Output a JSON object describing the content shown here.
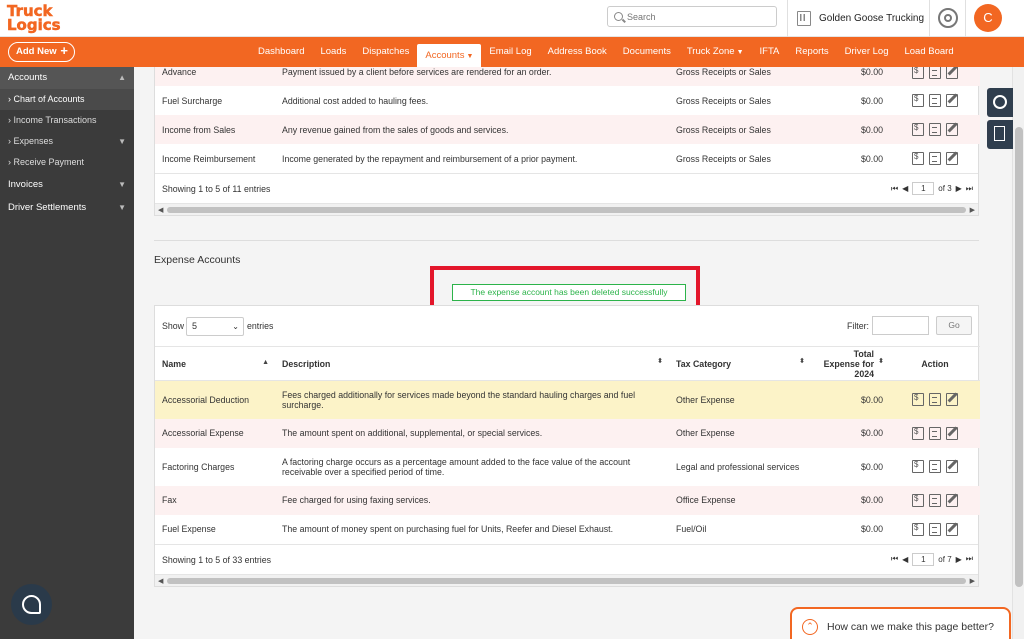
{
  "brand": {
    "logo_line1": "Truck",
    "logo_line2": "Logics"
  },
  "search": {
    "placeholder": "Search"
  },
  "company": {
    "name": "Golden Goose Trucking"
  },
  "user": {
    "initial": "C"
  },
  "nav": {
    "add_new": "Add New",
    "items": [
      "Dashboard",
      "Loads",
      "Dispatches",
      "Accounts",
      "Email Log",
      "Address Book",
      "Documents",
      "Truck Zone",
      "IFTA",
      "Reports",
      "Driver Log",
      "Load Board"
    ],
    "active": "Accounts"
  },
  "sidebar": {
    "accounts": "Accounts",
    "subs": [
      "Chart of Accounts",
      "Income Transactions",
      "Expenses",
      "Receive Payment"
    ],
    "invoices": "Invoices",
    "driver_settlements": "Driver Settlements"
  },
  "income_table": {
    "rows": [
      {
        "name": "Advance",
        "description": "Payment issued by a client before services are rendered for an order.",
        "tax": "Gross Receipts or Sales",
        "amount": "$0.00"
      },
      {
        "name": "Fuel Surcharge",
        "description": "Additional cost added to hauling fees.",
        "tax": "Gross Receipts or Sales",
        "amount": "$0.00"
      },
      {
        "name": "Income from Sales",
        "description": "Any revenue gained from the sales of goods and services.",
        "tax": "Gross Receipts or Sales",
        "amount": "$0.00"
      },
      {
        "name": "Income Reimbursement",
        "description": "Income generated by the repayment and reimbursement of a prior payment.",
        "tax": "Gross Receipts or Sales",
        "amount": "$0.00"
      }
    ],
    "info": "Showing 1 to 5 of 11 entries",
    "page": "1",
    "of_pages": "of 3"
  },
  "expense_section": {
    "title": "Expense Accounts",
    "alert": "The expense account has been deleted successfully",
    "show_label": "Show",
    "show_value": "5",
    "entries_label": "entries",
    "filter_label": "Filter:",
    "go": "Go",
    "headers": {
      "name": "Name",
      "description": "Description",
      "tax": "Tax Category",
      "total": "Total Expense for 2024",
      "action": "Action"
    },
    "rows": [
      {
        "name": "Accessorial Deduction",
        "description": "Fees charged additionally for services made beyond the standard hauling charges and fuel surcharge.",
        "tax": "Other Expense",
        "amount": "$0.00"
      },
      {
        "name": "Accessorial Expense",
        "description": "The amount spent on additional, supplemental, or special services.",
        "tax": "Other Expense",
        "amount": "$0.00"
      },
      {
        "name": "Factoring Charges",
        "description": "A factoring charge occurs as a percentage amount added to the face value of the account receivable over a specified period of time.",
        "tax": "Legal and professional services",
        "amount": "$0.00"
      },
      {
        "name": "Fax",
        "description": "Fee charged for using faxing services.",
        "tax": "Office Expense",
        "amount": "$0.00"
      },
      {
        "name": "Fuel Expense",
        "description": "The amount of money spent on purchasing fuel for Units, Reefer and Diesel Exhaust.",
        "tax": "Fuel/Oil",
        "amount": "$0.00"
      }
    ],
    "info": "Showing 1 to 5 of 33 entries",
    "page": "1",
    "of_pages": "of 7"
  },
  "feedback": {
    "text": "How can we make this page better?"
  },
  "colors": {
    "brand": "#f26722",
    "sidebar": "#3b3b3b",
    "success": "#2cb34a",
    "highlight_box": "#e3162b"
  }
}
